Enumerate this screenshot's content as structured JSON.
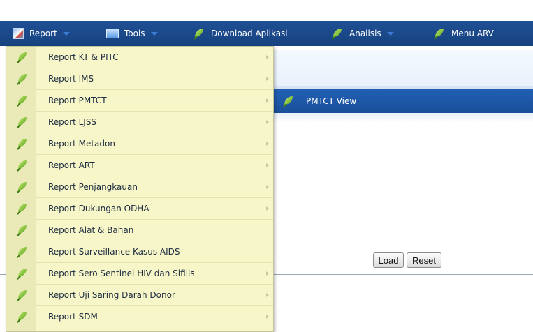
{
  "menubar": {
    "items": [
      {
        "label": "Report",
        "icon": "report-icon",
        "has_dropdown": true
      },
      {
        "label": "Tools",
        "icon": "tools-icon",
        "has_dropdown": true
      },
      {
        "label": "Download Aplikasi",
        "icon": "leaf-icon",
        "has_dropdown": false
      },
      {
        "label": "Analisis",
        "icon": "leaf-icon",
        "has_dropdown": true
      },
      {
        "label": "Menu ARV",
        "icon": "leaf-icon",
        "has_dropdown": false
      }
    ]
  },
  "report_menu": {
    "items": [
      {
        "label": "Report KT & PITC",
        "has_submenu": true
      },
      {
        "label": "Report IMS",
        "has_submenu": true
      },
      {
        "label": "Report PMTCT",
        "has_submenu": true
      },
      {
        "label": "Report LJSS",
        "has_submenu": true
      },
      {
        "label": "Report Metadon",
        "has_submenu": true
      },
      {
        "label": "Report ART",
        "has_submenu": true
      },
      {
        "label": "Report Penjangkauan",
        "has_submenu": true
      },
      {
        "label": "Report Dukungan ODHA",
        "has_submenu": true
      },
      {
        "label": "Report Alat & Bahan",
        "has_submenu": false
      },
      {
        "label": "Report Surveillance Kasus AIDS",
        "has_submenu": false
      },
      {
        "label": "Report Sero Sentinel HIV dan Sifilis",
        "has_submenu": true
      },
      {
        "label": "Report Uji Saring Darah Donor",
        "has_submenu": true
      },
      {
        "label": "Report SDM",
        "has_submenu": true
      }
    ]
  },
  "view": {
    "title": "PMTCT View",
    "icon": "leaf-icon"
  },
  "buttons": {
    "load": "Load",
    "reset": "Reset"
  },
  "colors": {
    "menubar": "#1c4a8c",
    "dropdown_bg": "#f6f6c8",
    "view_header": "#1e5aab"
  }
}
